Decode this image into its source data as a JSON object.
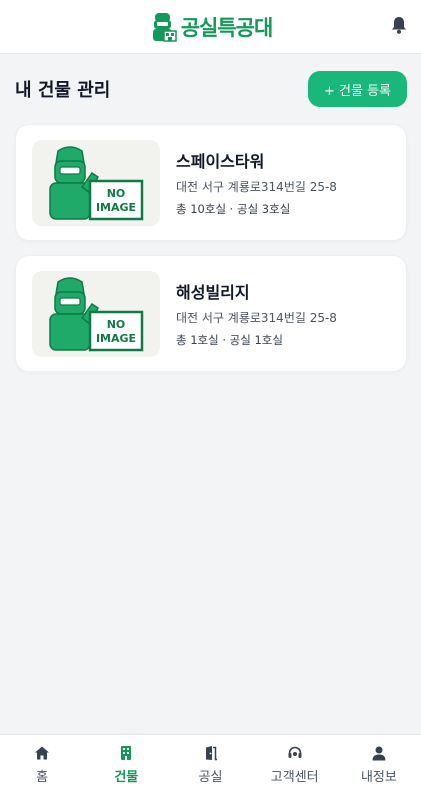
{
  "header": {
    "logo_text": "공실특공대",
    "logo_icon": "soldier-building-logo",
    "notification_icon": "bell-icon"
  },
  "page": {
    "title": "내 건물 관리",
    "add_button_label": "+ 건물 등록"
  },
  "buildings": [
    {
      "name": "스페이스타워",
      "address": "대전 서구 계룡로314번길 25-8",
      "stats": "총 10호실 · 공실 3호실",
      "image": "no-image-placeholder"
    },
    {
      "name": "해성빌리지",
      "address": "대전 서구 계룡로314번길 25-8",
      "stats": "총 1호실 · 공실 1호실",
      "image": "no-image-placeholder"
    }
  ],
  "placeholder": {
    "line1": "NO",
    "line2": "IMAGE"
  },
  "nav": [
    {
      "label": "홈",
      "icon": "home-icon",
      "active": false
    },
    {
      "label": "건물",
      "icon": "building-icon",
      "active": true
    },
    {
      "label": "공실",
      "icon": "door-icon",
      "active": false
    },
    {
      "label": "고객센터",
      "icon": "headset-icon",
      "active": false
    },
    {
      "label": "내정보",
      "icon": "user-icon",
      "active": false
    }
  ],
  "colors": {
    "brand": "#14995a",
    "button": "#19b77a",
    "background": "#f3f4f6"
  }
}
